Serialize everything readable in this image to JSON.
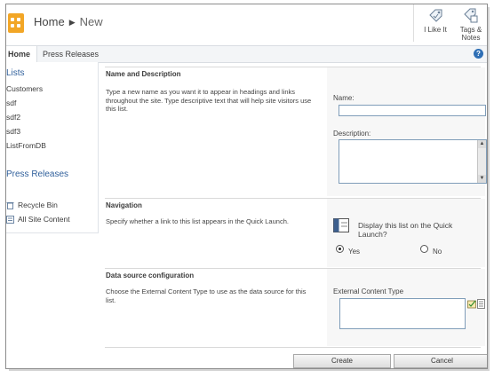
{
  "header": {
    "breadcrumb_site": "Home",
    "breadcrumb_page": "New",
    "like_label": "I Like It",
    "tags_label": "Tags & Notes"
  },
  "topnav": {
    "tabs": [
      {
        "label": "Home"
      },
      {
        "label": "Press Releases"
      }
    ],
    "help": "?"
  },
  "quicklaunch": {
    "lists_heading": "Lists",
    "lists": [
      "Customers",
      "sdf",
      "sdf2",
      "sdf3",
      "ListFromDB"
    ],
    "press_heading": "Press Releases",
    "recycle_bin": "Recycle Bin",
    "all_site_content": "All Site Content"
  },
  "sections": {
    "name_desc": {
      "title": "Name and Description",
      "description": "Type a new name as you want it to appear in headings and links throughout the site. Type descriptive text that will help site visitors use this list.",
      "name_label": "Name:",
      "name_value": "",
      "description_label": "Description:",
      "description_value": ""
    },
    "navigation": {
      "title": "Navigation",
      "description": "Specify whether a link to this list appears in the Quick Launch.",
      "question": "Display this list on the Quick Launch?",
      "yes": "Yes",
      "no": "No",
      "selected": "Yes"
    },
    "datasource": {
      "title": "Data source configuration",
      "description": "Choose the External Content Type to use as the data source for this list.",
      "field_label": "External Content Type",
      "value": ""
    }
  },
  "buttons": {
    "create": "Create",
    "cancel": "Cancel"
  }
}
